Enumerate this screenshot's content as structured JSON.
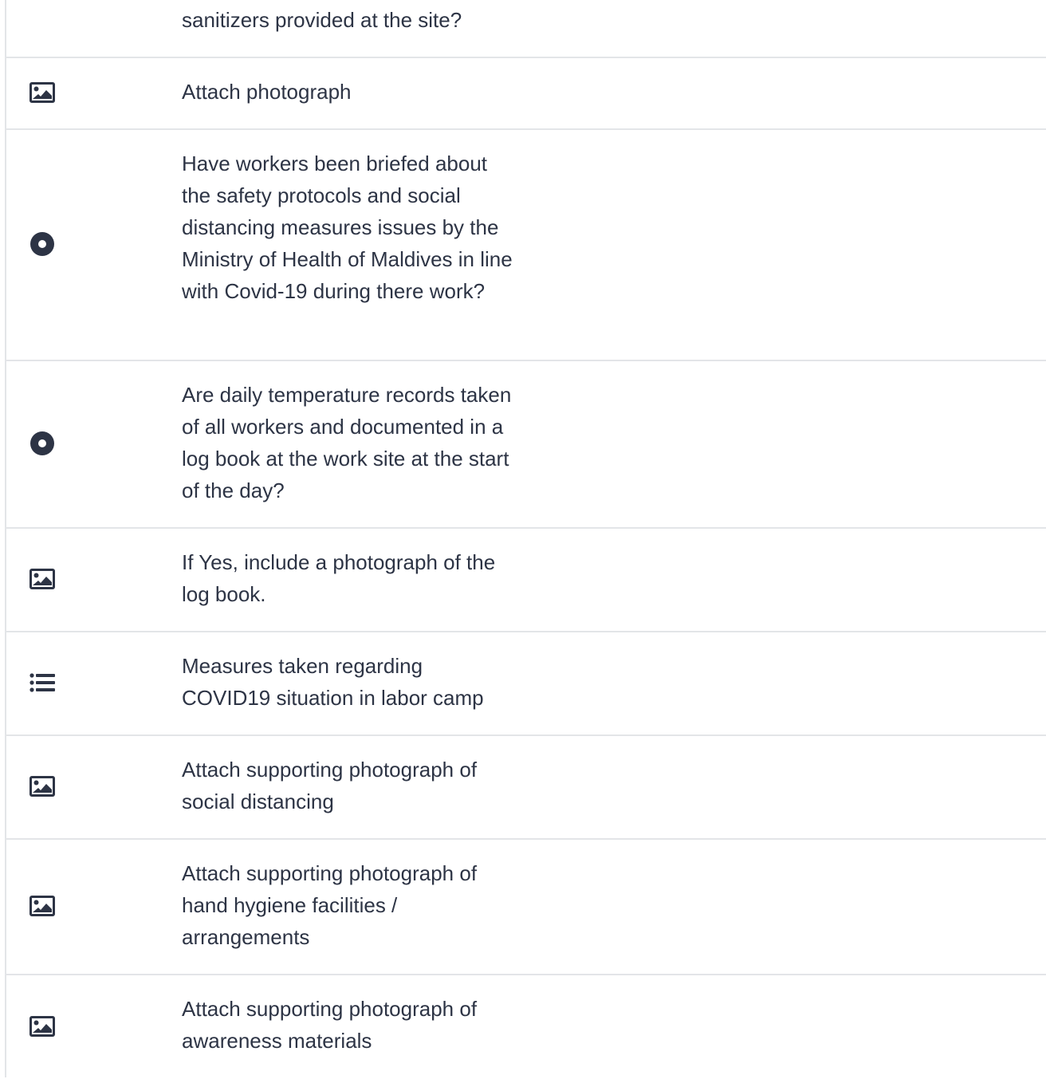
{
  "rows": [
    {
      "icon": "radio-icon",
      "text": "sanitizers provided at the site?"
    },
    {
      "icon": "image-icon",
      "text": "Attach photograph"
    },
    {
      "icon": "radio-icon",
      "text": "Have workers been briefed about the safety protocols and social distancing measures issues by the Ministry of Health of Maldives in line with Covid-19 during there work?"
    },
    {
      "icon": "radio-icon",
      "text": "Are daily temperature records taken of all workers and documented in a log book at the work site at the start of the day?"
    },
    {
      "icon": "image-icon",
      "text": "If Yes, include a photograph of the log book."
    },
    {
      "icon": "list-icon",
      "text": "Measures taken regarding COVID19 situation in labor camp"
    },
    {
      "icon": "image-icon",
      "text": "Attach supporting photograph of social distancing"
    },
    {
      "icon": "image-icon",
      "text": "Attach supporting photograph of hand hygiene facilities / arrangements"
    },
    {
      "icon": "image-icon",
      "text": "Attach supporting photograph of awareness materials"
    }
  ]
}
